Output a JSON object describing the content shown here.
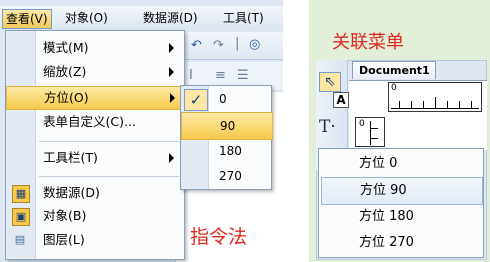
{
  "menubar": {
    "items": [
      "查看(V)",
      "对象(O)",
      "数据源(D)",
      "工具(T)"
    ]
  },
  "view_menu": {
    "items": [
      {
        "label": "模式(M)",
        "has_submenu": true
      },
      {
        "label": "缩放(Z)",
        "has_submenu": true
      },
      {
        "label": "方位(O)",
        "has_submenu": true,
        "highlighted": true
      },
      {
        "label": "表单自定义(C)...",
        "has_submenu": false
      },
      {
        "label": "工具栏(T)",
        "has_submenu": true
      },
      {
        "label": "数据源(D)",
        "has_submenu": false,
        "icon": "datasource-icon"
      },
      {
        "label": "对象(B)",
        "has_submenu": false,
        "icon": "object-icon"
      },
      {
        "label": "图层(L)",
        "has_submenu": false,
        "icon": "layer-icon"
      }
    ]
  },
  "orientation_submenu": {
    "items": [
      {
        "label": "0",
        "checked": true
      },
      {
        "label": "90",
        "highlighted": true
      },
      {
        "label": "180"
      },
      {
        "label": "270"
      }
    ]
  },
  "captions": {
    "command_method": "指令法",
    "context_menu": "关联菜单"
  },
  "document": {
    "tab_title": "Document1",
    "ruler_zero": "0"
  },
  "context_menu": {
    "items": [
      "方位 0",
      "方位 90",
      "方位 180",
      "方位 270"
    ],
    "hovered_index": 1
  },
  "colors": {
    "highlight": "#f6c94a",
    "caption_red": "#e0271f",
    "right_bg": "#e2efd9"
  }
}
